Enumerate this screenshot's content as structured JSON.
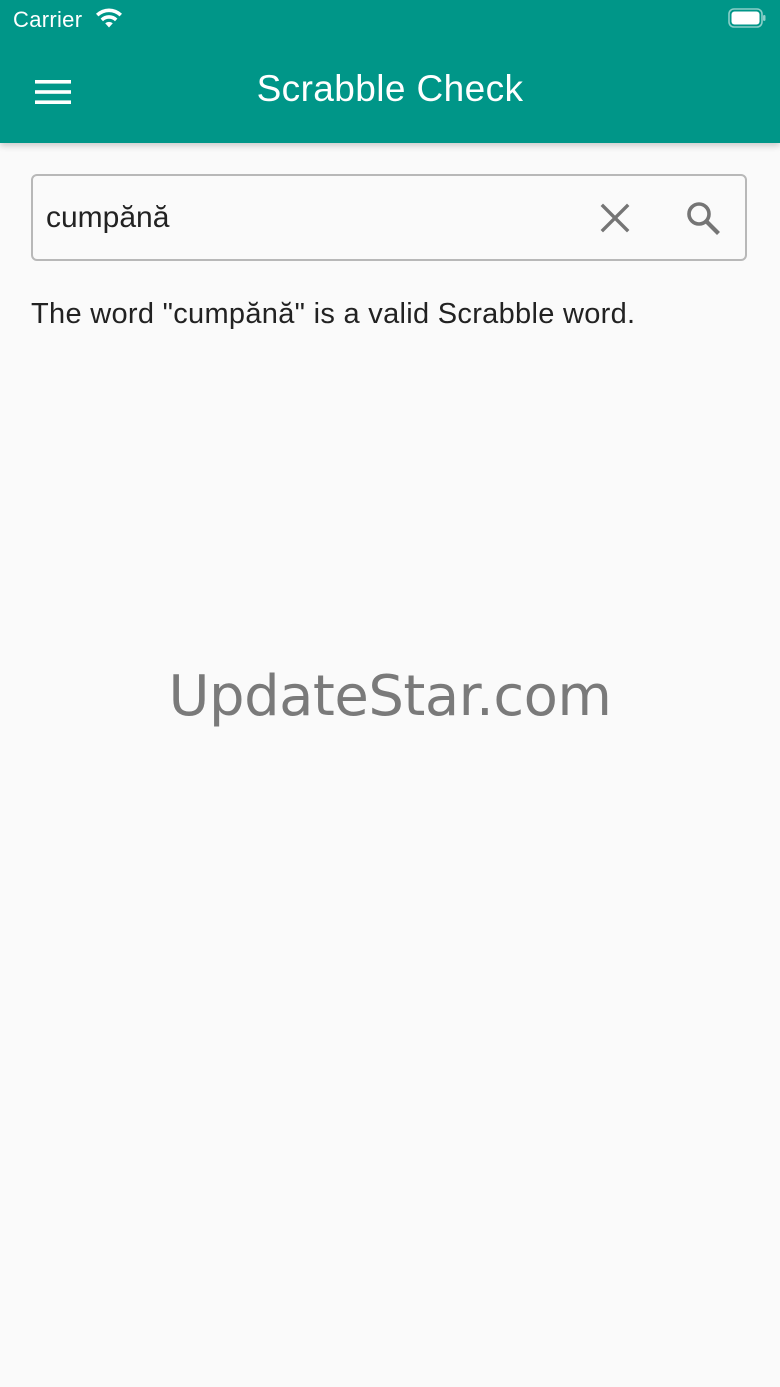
{
  "status_bar": {
    "carrier": "Carrier",
    "wifi_icon": "wifi-icon",
    "battery_icon": "battery-icon"
  },
  "app_bar": {
    "title": "Scrabble Check",
    "menu_icon": "hamburger-menu-icon",
    "background_color": "#009688"
  },
  "search": {
    "value": "cumpănă",
    "placeholder": "",
    "clear_icon": "close-icon",
    "search_icon": "search-icon"
  },
  "result": {
    "text": "The word \"cumpănă\" is a valid Scrabble word."
  },
  "watermark": {
    "text": "UpdateStar.com"
  }
}
